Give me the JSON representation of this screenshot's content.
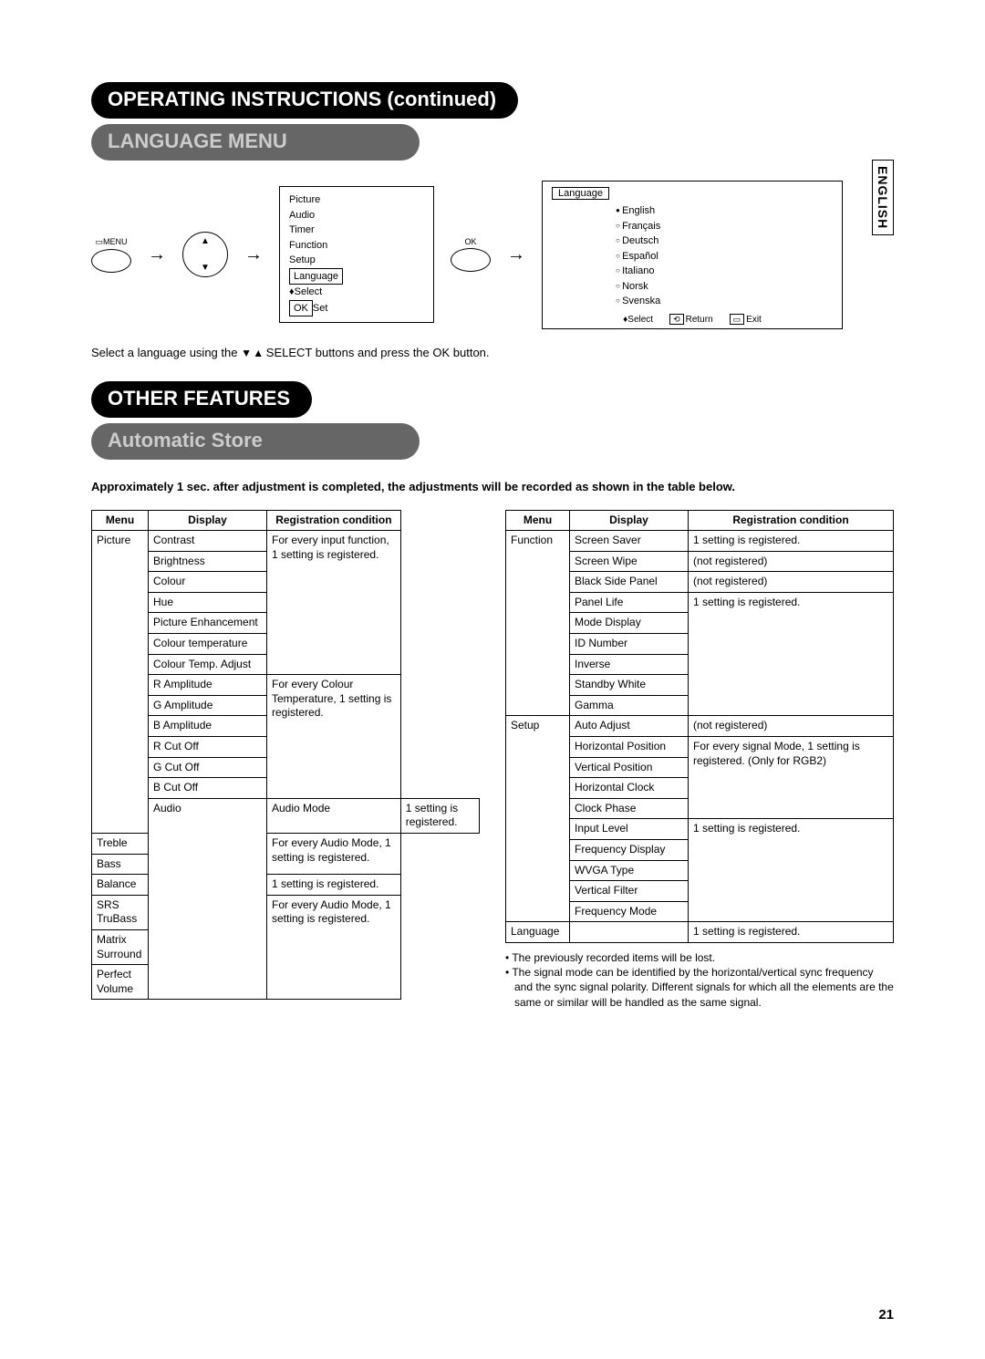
{
  "side_tab": "ENGLISH",
  "headings": {
    "op_instr": "OPERATING INSTRUCTIONS (continued)",
    "lang_menu": "LANGUAGE MENU",
    "other_feat": "OTHER FEATURES",
    "auto_store": "Automatic Store"
  },
  "diagram": {
    "menu_label": "MENU",
    "ok_label": "OK",
    "menu_items": [
      "Picture",
      "Audio",
      "Timer",
      "Function",
      "Setup"
    ],
    "menu_sel": "Language",
    "menu_foot1": "Select",
    "menu_foot2_box": "OK",
    "menu_foot2": "Set",
    "lang_title": "Language",
    "langs": [
      {
        "name": "English",
        "sel": true
      },
      {
        "name": "Français",
        "sel": false
      },
      {
        "name": "Deutsch",
        "sel": false
      },
      {
        "name": "Español",
        "sel": false
      },
      {
        "name": "Italiano",
        "sel": false
      },
      {
        "name": "Norsk",
        "sel": false
      },
      {
        "name": "Svenska",
        "sel": false
      }
    ],
    "foot_select": "Select",
    "foot_return": "Return",
    "foot_exit": "Exit"
  },
  "caption_pre": "Select a language using the ",
  "caption_post": " SELECT buttons and press the OK button.",
  "intro": "Approximately 1 sec. after adjustment is completed, the adjustments will be recorded as shown in the table below.",
  "headers": {
    "menu": "Menu",
    "display": "Display",
    "cond": "Registration condition"
  },
  "left_rows": [
    {
      "menu": "Picture",
      "display": "Contrast",
      "cond": "For every input function, 1 setting is registered.",
      "mr": 14,
      "cr": 7
    },
    {
      "display": "Brightness"
    },
    {
      "display": "Colour"
    },
    {
      "display": "Hue"
    },
    {
      "display": "Picture Enhancement"
    },
    {
      "display": "Colour temperature"
    },
    {
      "display": "Colour Temp. Adjust"
    },
    {
      "display": "R Amplitude",
      "ralign": true,
      "cond": "For every Colour Temperature, 1 setting is registered.",
      "cr": 6
    },
    {
      "display": "G Amplitude",
      "ralign": true
    },
    {
      "display": "B Amplitude",
      "ralign": true
    },
    {
      "display": "R Cut Off",
      "ralign": true
    },
    {
      "display": "G Cut Off",
      "ralign": true
    },
    {
      "display": "B Cut Off",
      "ralign": true
    },
    {
      "menu": "Audio",
      "display": "Audio Mode",
      "cond": "1 setting is registered.",
      "mr": 7
    },
    {
      "display": "Treble",
      "cond": "For every Audio Mode, 1 setting is registered.",
      "cr": 2
    },
    {
      "display": "Bass"
    },
    {
      "display": "Balance",
      "cond": "1 setting is registered."
    },
    {
      "display": "SRS TruBass",
      "cond": "For every Audio Mode, 1 setting is registered.",
      "cr": 3
    },
    {
      "display": "Matrix Surround"
    },
    {
      "display": "Perfect Volume"
    }
  ],
  "right_rows": [
    {
      "menu": "Function",
      "display": "Screen Saver",
      "cond": "1 setting is registered.",
      "mr": 9
    },
    {
      "display": "Screen Wipe",
      "cond": "(not registered)"
    },
    {
      "display": "Black Side Panel",
      "cond": "(not registered)"
    },
    {
      "display": "Panel Life",
      "cond": "1 setting is registered.",
      "cr": 6
    },
    {
      "display": "Mode Display"
    },
    {
      "display": "ID Number"
    },
    {
      "display": "Inverse"
    },
    {
      "display": "Standby White"
    },
    {
      "display": "Gamma"
    },
    {
      "menu": "Setup",
      "display": "Auto Adjust",
      "cond": "(not registered)",
      "mr": 10
    },
    {
      "display": "Horizontal Position",
      "cond": "For every signal Mode, 1 setting is registered. (Only for RGB2)",
      "cr": 4
    },
    {
      "display": "Vertical Position"
    },
    {
      "display": "Horizontal Clock"
    },
    {
      "display": "Clock Phase"
    },
    {
      "display": "Input Level",
      "cond": "1 setting is registered.",
      "cr": 5
    },
    {
      "display": "Frequency Display"
    },
    {
      "display": "WVGA Type"
    },
    {
      "display": "Vertical Filter"
    },
    {
      "display": "Frequency Mode"
    },
    {
      "menu": "Language",
      "display": "",
      "cond": "1 setting is registered."
    }
  ],
  "notes": [
    "The previously recorded items will be lost.",
    "The signal mode can be identified by the horizontal/vertical sync frequency and the sync signal polarity. Different signals for which all the elements are the same or similar will be handled as the same signal."
  ],
  "page_num": "21"
}
